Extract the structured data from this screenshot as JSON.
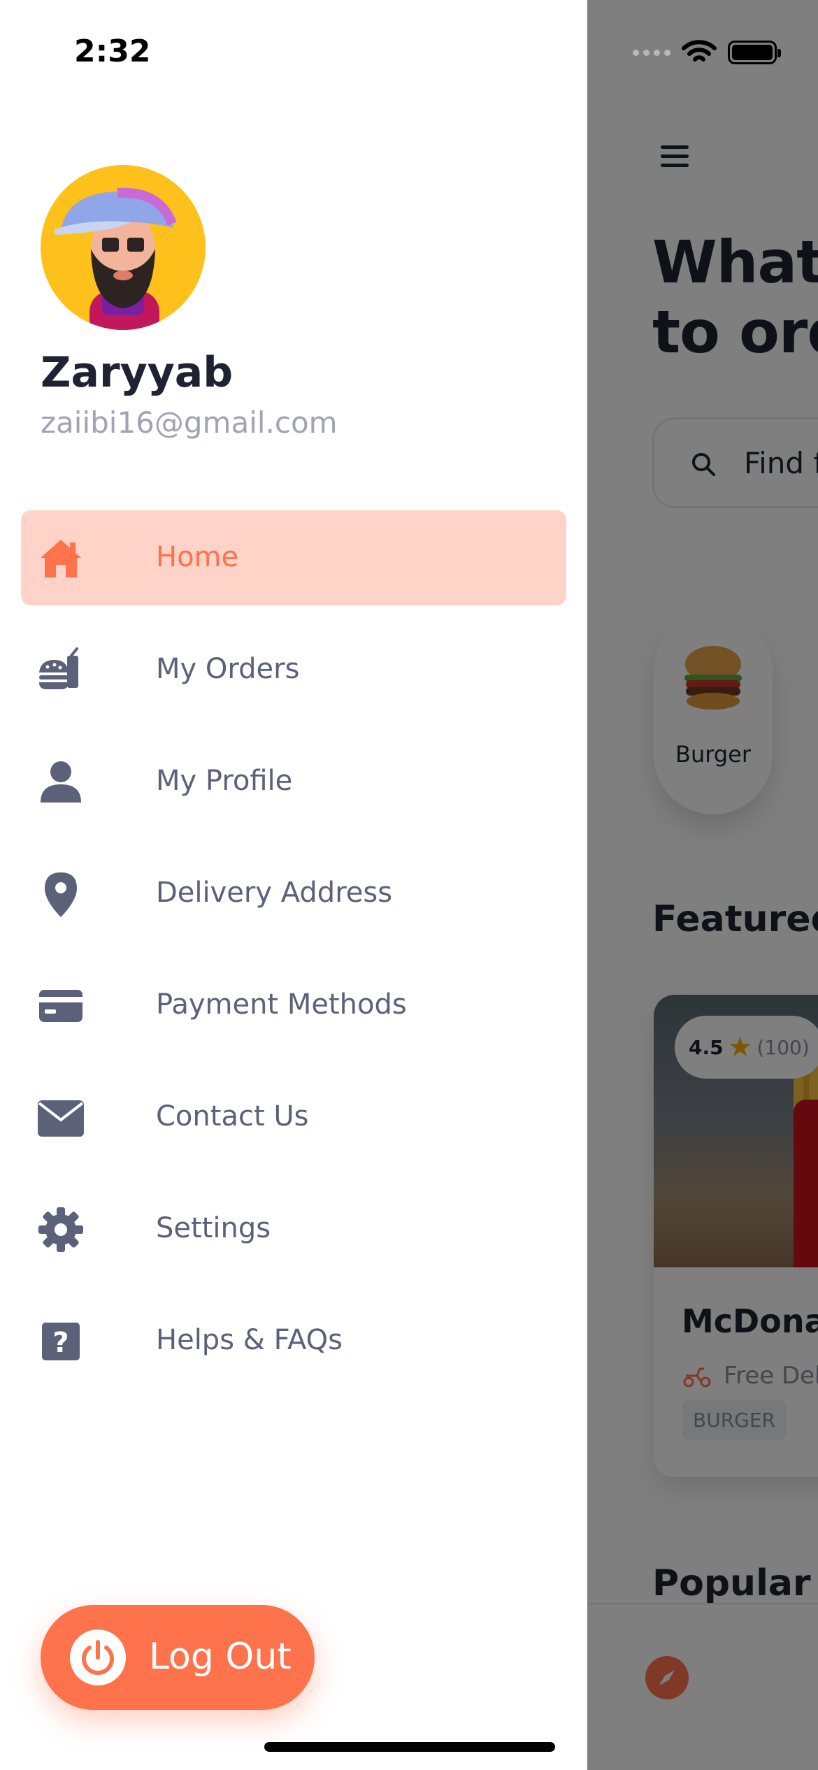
{
  "status_bar": {
    "time": "2:32"
  },
  "user": {
    "name": "Zaryyab",
    "email": "zaiibi16@gmail.com"
  },
  "menu": {
    "items": [
      {
        "label": "Home",
        "icon": "home-icon",
        "active": true
      },
      {
        "label": "My Orders",
        "icon": "orders-icon",
        "active": false
      },
      {
        "label": "My Profile",
        "icon": "profile-icon",
        "active": false
      },
      {
        "label": "Delivery Address",
        "icon": "location-pin-icon",
        "active": false
      },
      {
        "label": "Payment Methods",
        "icon": "credit-card-icon",
        "active": false
      },
      {
        "label": "Contact Us",
        "icon": "envelope-icon",
        "active": false
      },
      {
        "label": "Settings",
        "icon": "gear-icon",
        "active": false
      },
      {
        "label": "Helps & FAQs",
        "icon": "help-icon",
        "active": false
      }
    ]
  },
  "logout": {
    "label": "Log Out"
  },
  "main": {
    "headline": "What\nto ord",
    "search_placeholder": "Find f",
    "category": {
      "label": "Burger"
    },
    "featured_title": "Featured",
    "featured_card": {
      "rating": "4.5",
      "rating_count": "(100)",
      "name": "McDonal",
      "delivery": "Free Del",
      "tag": "BURGER"
    },
    "popular_title": "Popular I"
  },
  "colors": {
    "accent": "#FE724C",
    "active_bg": "#FFD3C7",
    "menu_text": "#5B6178",
    "email_text": "#A0A3B1",
    "avatar_bg": "#FEC01A"
  }
}
